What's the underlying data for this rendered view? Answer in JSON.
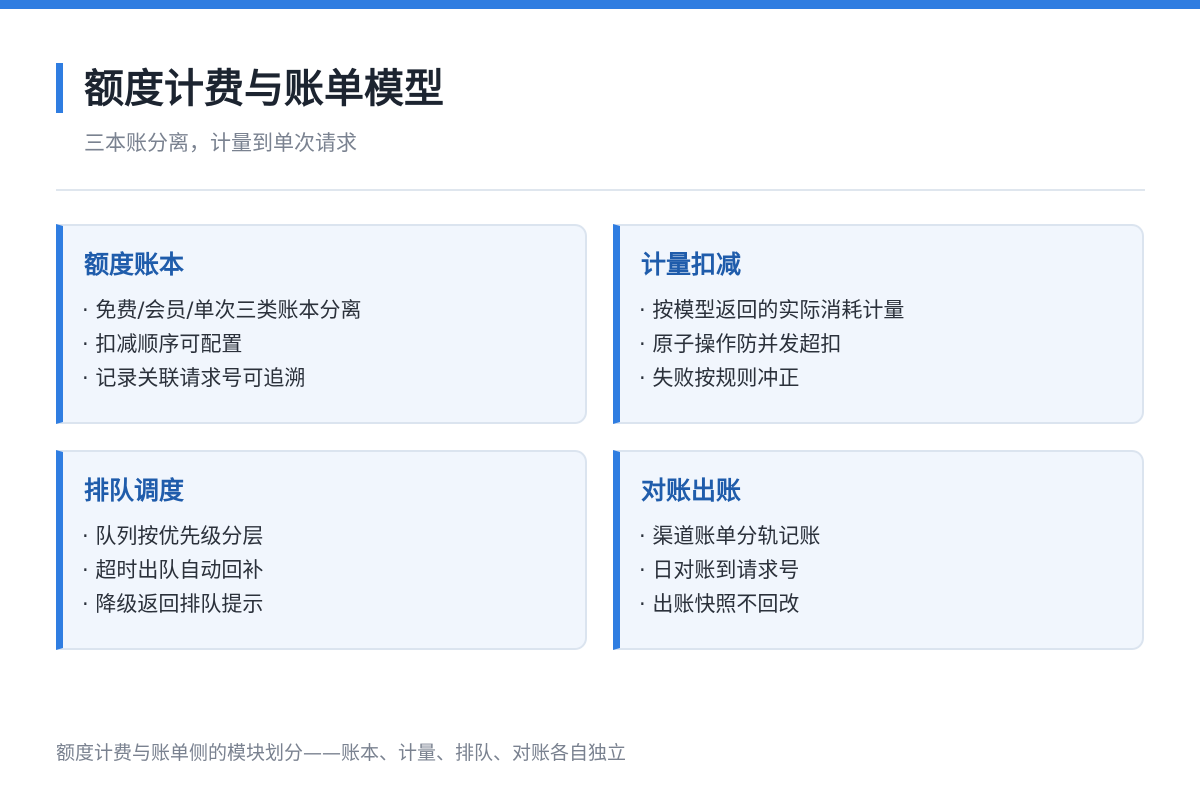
{
  "header": {
    "title": "额度计费与账单模型",
    "subtitle": "三本账分离，计量到单次请求"
  },
  "cards": [
    {
      "title": "额度账本",
      "items": [
        "· 免费/会员/单次三类账本分离",
        "· 扣减顺序可配置",
        "· 记录关联请求号可追溯"
      ]
    },
    {
      "title": "计量扣减",
      "items": [
        "· 按模型返回的实际消耗计量",
        "· 原子操作防并发超扣",
        "· 失败按规则冲正"
      ]
    },
    {
      "title": "排队调度",
      "items": [
        "· 队列按优先级分层",
        "· 超时出队自动回补",
        "· 降级返回排队提示"
      ]
    },
    {
      "title": "对账出账",
      "items": [
        "· 渠道账单分轨记账",
        "· 日对账到请求号",
        "· 出账快照不回改"
      ]
    }
  ],
  "footer": {
    "note": "额度计费与账单侧的模块划分——账本、计量、排队、对账各自独立"
  },
  "colors": {
    "accent": "#2f7de1",
    "card_title": "#1f5cab",
    "card_background": "#f1f6fd",
    "text": "#2b313b",
    "muted": "#7a8290"
  }
}
